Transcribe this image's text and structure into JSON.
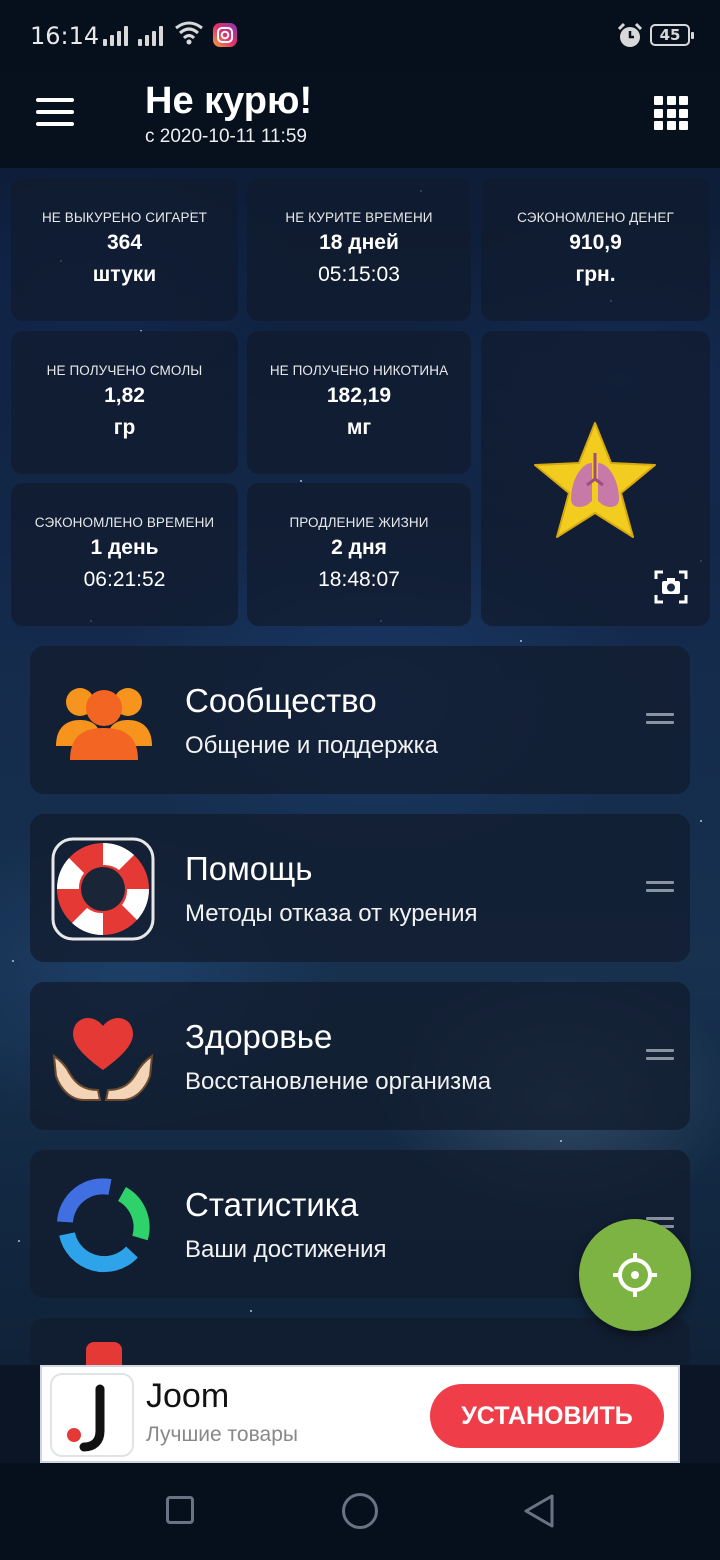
{
  "status_bar": {
    "time": "16:14",
    "battery": "45",
    "icons": [
      "signal-icon",
      "signal-icon",
      "wifi-icon",
      "instagram-icon",
      "alarm-icon",
      "battery-icon"
    ]
  },
  "app_bar": {
    "title": "Не курю!",
    "subtitle": "с 2020-10-11 11:59",
    "menu_icon": "hamburger-menu-icon",
    "grid_icon": "apps-grid-icon"
  },
  "stats": [
    {
      "label": "НЕ ВЫКУРЕНО СИГАРЕТ",
      "value": "364",
      "unit": "штуки"
    },
    {
      "label": "НЕ КУРИТЕ ВРЕМЕНИ",
      "value": "18 дней",
      "unit": "05:15:03"
    },
    {
      "label": "СЭКОНОМЛЕНО ДЕНЕГ",
      "value": "910,9",
      "unit": "грн."
    },
    {
      "label": "НЕ ПОЛУЧЕНО СМОЛЫ",
      "value": "1,82",
      "unit": "гр"
    },
    {
      "label": "НЕ ПОЛУЧЕНО НИКОТИНА",
      "value": "182,19",
      "unit": "мг"
    },
    {
      "label": "СЭКОНОМЛЕНО ВРЕМЕНИ",
      "value": "1 день",
      "unit": "06:21:52"
    },
    {
      "label": "ПРОДЛЕНИЕ ЖИЗНИ",
      "value": "2 дня",
      "unit": "18:48:07"
    }
  ],
  "achievement": {
    "icon": "star-lungs-icon",
    "camera_icon": "camera-icon"
  },
  "menu": [
    {
      "title": "Сообщество",
      "subtitle": "Общение и поддержка",
      "icon": "people-icon"
    },
    {
      "title": "Помощь",
      "subtitle": "Методы отказа от курения",
      "icon": "lifebuoy-icon"
    },
    {
      "title": "Здоровье",
      "subtitle": "Восстановление организма",
      "icon": "heart-hands-icon"
    },
    {
      "title": "Статистика",
      "subtitle": "Ваши достижения",
      "icon": "statistics-ring-icon"
    }
  ],
  "fab": {
    "icon": "crosshair-icon",
    "color": "#7cb342"
  },
  "ad": {
    "title": "Joom",
    "subtitle": "Лучшие товары",
    "button": "УСТАНОВИТЬ",
    "button_color": "#ef3e4a"
  },
  "nav": {
    "icons": [
      "recents-square-icon",
      "home-circle-icon",
      "back-triangle-icon"
    ]
  }
}
